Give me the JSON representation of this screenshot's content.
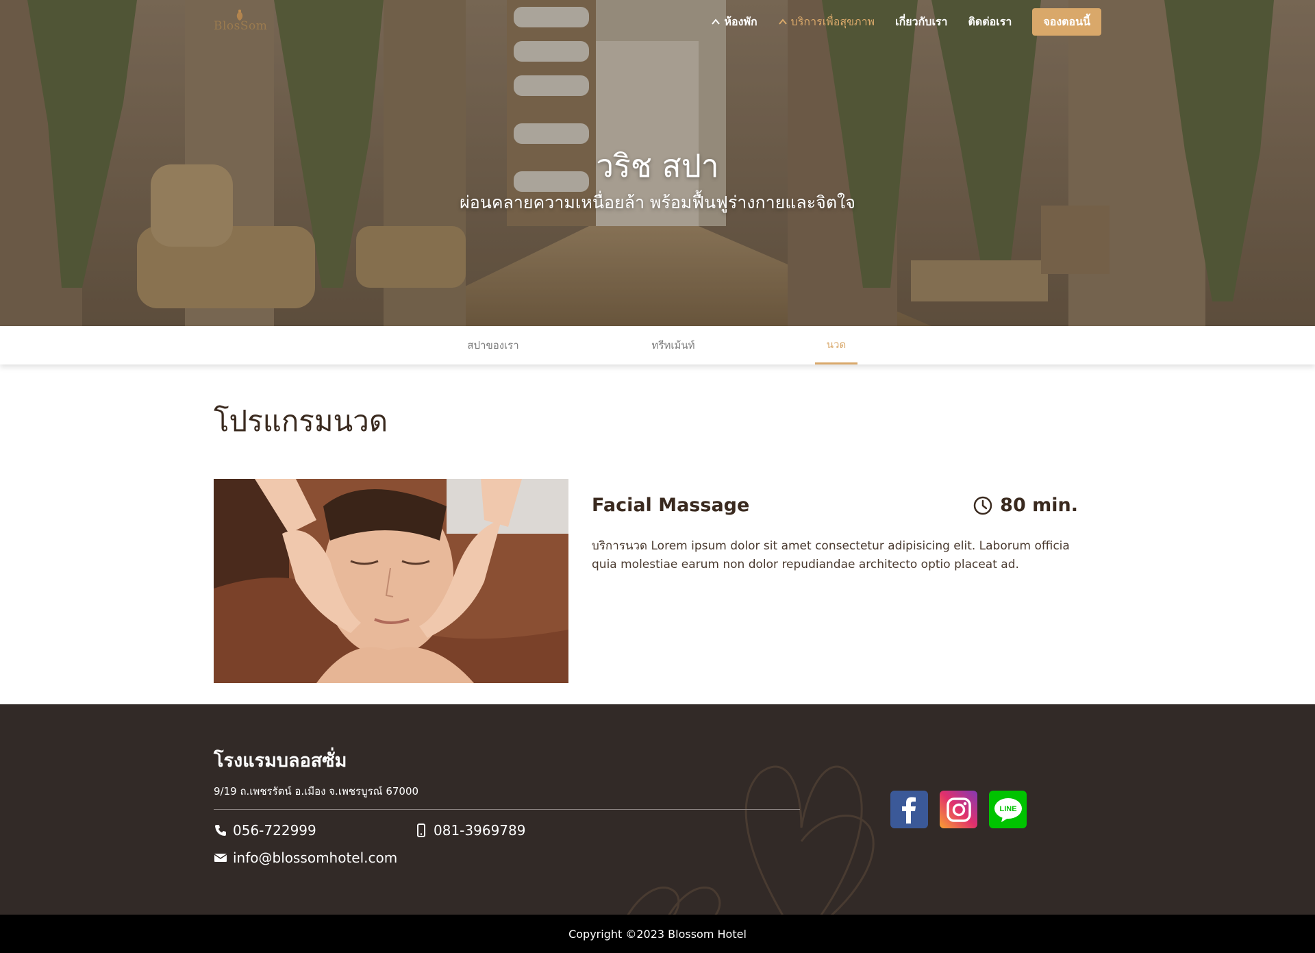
{
  "header": {
    "logo_text": "BlosSom",
    "nav": [
      {
        "label": "ห้องพัก",
        "has_chevron": true,
        "active": false
      },
      {
        "label": "บริการเพื่อสุขภาพ",
        "has_chevron": true,
        "active": true
      },
      {
        "label": "เกี่ยวกับเรา",
        "has_chevron": false,
        "active": false
      },
      {
        "label": "ติดต่อเรา",
        "has_chevron": false,
        "active": false
      }
    ],
    "book_button": "จองตอนนี้"
  },
  "hero": {
    "title": "วริช สปา",
    "subtitle": "ผ่อนคลายความเหนื่อยล้า พร้อมฟื้นฟูร่างกายและจิตใจ"
  },
  "tabs": [
    {
      "label": "สปาของเรา",
      "active": false
    },
    {
      "label": "ทรีทเม้นท์",
      "active": false
    },
    {
      "label": "นวด",
      "active": true
    }
  ],
  "main": {
    "section_title": "โปรแกรมนวด",
    "program": {
      "name": "Facial Massage",
      "duration": "80 min.",
      "description": "บริการนวด Lorem ipsum dolor sit amet consectetur adipisicing elit. Laborum officia quia molestiae earum non dolor repudiandae architecto optio placeat ad."
    }
  },
  "footer": {
    "hotel_name": "โรงแรมบลอสซั่ม",
    "address": "9/19 ถ.เพชรรัตน์ อ.เมือง จ.เพชรบูรณ์ 67000",
    "phone": "056-722999",
    "mobile": "081-3969789",
    "email": "info@blossomhotel.com",
    "socials": [
      "facebook-icon",
      "instagram-icon",
      "line-icon"
    ]
  },
  "copyright": "Copyright ©2023 Blossom Hotel",
  "colors": {
    "accent": "#d9a86a",
    "text_dark": "#3a2a1f",
    "footer_bg": "#322a27",
    "copyright_bg": "#000000"
  }
}
